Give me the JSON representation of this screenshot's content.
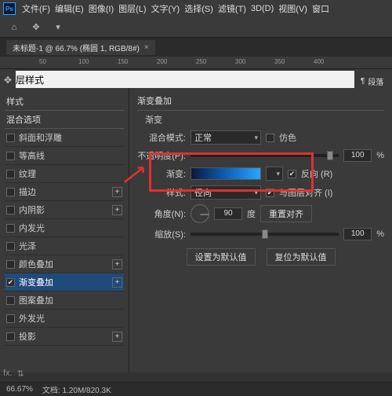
{
  "menu": {
    "file": "文件(F)",
    "edit": "编辑(E)",
    "image": "图像(I)",
    "layer": "图层(L)",
    "type": "文字(Y)",
    "select": "选择(S)",
    "filter": "滤镜(T)",
    "threeD": "3D(D)",
    "view": "视图(V)",
    "window": "窗口"
  },
  "doc_tab": {
    "title": "未标题-1 @ 66.7% (椭圆 1, RGB/8#)",
    "close": "×"
  },
  "ruler_ticks": [
    "50",
    "100",
    "150",
    "200",
    "250",
    "300",
    "350",
    "400"
  ],
  "panel": {
    "paragraph": "段落"
  },
  "dialog_title": "图层样式",
  "styles": {
    "header": "样式",
    "blend": "混合选项",
    "items": [
      {
        "label": "斜面和浮雕",
        "checked": false,
        "plus": false
      },
      {
        "label": "等高线",
        "checked": false,
        "plus": false
      },
      {
        "label": "纹理",
        "checked": false,
        "plus": false
      },
      {
        "label": "描边",
        "checked": false,
        "plus": true
      },
      {
        "label": "内阴影",
        "checked": false,
        "plus": true
      },
      {
        "label": "内发光",
        "checked": false,
        "plus": false
      },
      {
        "label": "光泽",
        "checked": false,
        "plus": false
      },
      {
        "label": "颜色叠加",
        "checked": false,
        "plus": true
      },
      {
        "label": "渐变叠加",
        "checked": true,
        "plus": true,
        "active": true
      },
      {
        "label": "图案叠加",
        "checked": false,
        "plus": false
      },
      {
        "label": "外发光",
        "checked": false,
        "plus": false
      },
      {
        "label": "投影",
        "checked": false,
        "plus": true
      }
    ]
  },
  "grad": {
    "title": "渐变叠加",
    "sub": "渐变",
    "blend_label": "混合模式:",
    "blend_value": "正常",
    "dither": "仿色",
    "opacity_label": "不透明度(P):",
    "opacity_value": "100",
    "pct": "%",
    "gradient_label": "渐变:",
    "reverse": "反向 (R)",
    "style_label": "样式:",
    "style_value": "径向",
    "align": "与图层对齐 (I)",
    "angle_label": "角度(N):",
    "angle_value": "90",
    "deg": "度",
    "reset_align": "重置对齐",
    "scale_label": "缩放(S):",
    "scale_value": "100",
    "btn_default": "设置为默认值",
    "btn_reset": "复位为默认值"
  },
  "status": {
    "zoom": "66.67%",
    "doc": "文档: 1.20M/820.3K"
  }
}
